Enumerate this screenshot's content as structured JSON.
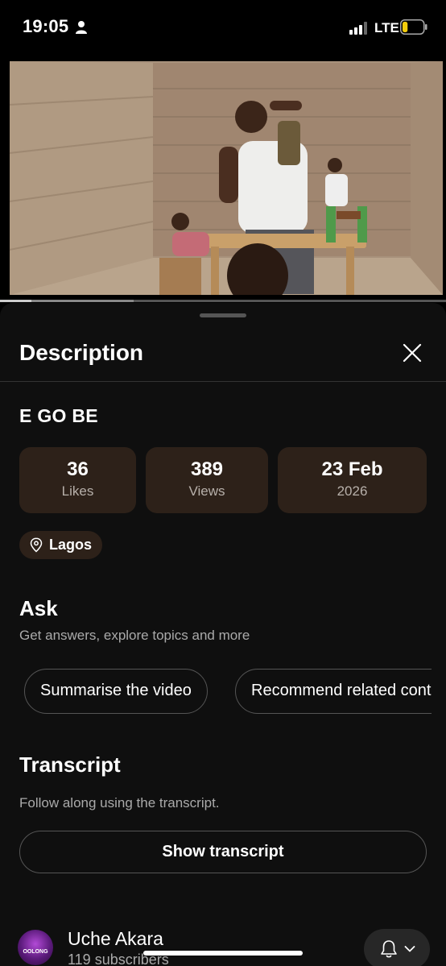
{
  "status_bar": {
    "time": "19:05",
    "network": "LTE",
    "battery_level": 0.25,
    "icons": [
      "person-icon",
      "signal-icon",
      "battery-icon"
    ]
  },
  "video": {
    "progress": 0.07,
    "buffered": 0.3
  },
  "description_panel": {
    "title": "Description",
    "video_title": "E GO BE",
    "stats": {
      "likes": {
        "value": "36",
        "label": "Likes"
      },
      "views": {
        "value": "389",
        "label": "Views"
      },
      "date": {
        "value": "23 Feb",
        "label": "2026"
      }
    },
    "location": "Lagos",
    "ask": {
      "title": "Ask",
      "subtitle": "Get answers, explore topics and more",
      "chips": [
        "Summarise the video",
        "Recommend related content"
      ]
    },
    "transcript": {
      "title": "Transcript",
      "subtitle": "Follow along using the transcript.",
      "button": "Show transcript"
    },
    "channel": {
      "name": "Uche Akara",
      "subscribers": "119 subscribers",
      "avatar_text": "OOLONG"
    }
  },
  "colors": {
    "sheet_bg": "#0f0f0f",
    "chip_brown": "#2d2119",
    "secondary_text": "#aaaaaa"
  }
}
